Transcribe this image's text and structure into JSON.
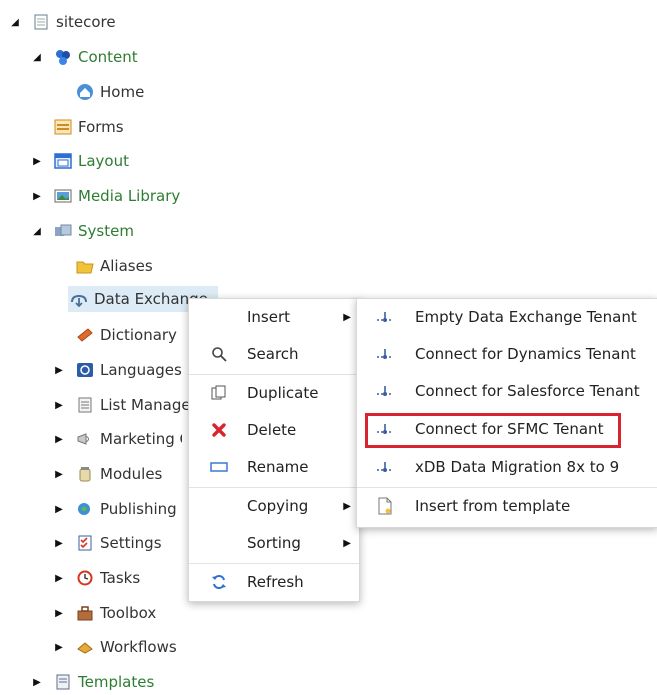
{
  "tree": {
    "items": [
      {
        "label": "sitecore",
        "icon": "page-icon",
        "expanded": true
      },
      {
        "label": "Content",
        "icon": "content-icon",
        "expanded": true
      },
      {
        "label": "Home",
        "icon": "home-icon",
        "expanded": null
      },
      {
        "label": "Forms",
        "icon": "forms-icon",
        "expanded": null
      },
      {
        "label": "Layout",
        "icon": "layout-icon",
        "expanded": false
      },
      {
        "label": "Media Library",
        "icon": "media-icon",
        "expanded": false
      },
      {
        "label": "System",
        "icon": "system-icon",
        "expanded": true
      },
      {
        "label": "Aliases",
        "icon": "folder-icon",
        "expanded": null
      },
      {
        "label": "Data Exchange",
        "icon": "data-exchange-icon",
        "expanded": null,
        "selected": true
      },
      {
        "label": "Dictionary",
        "icon": "book-icon",
        "expanded": null
      },
      {
        "label": "Languages",
        "icon": "globe-icon",
        "expanded": false
      },
      {
        "label": "List Manager",
        "icon": "list-icon",
        "expanded": false
      },
      {
        "label": "Marketing Control Panel",
        "icon": "megaphone-icon",
        "expanded": false
      },
      {
        "label": "Modules",
        "icon": "jar-icon",
        "expanded": false
      },
      {
        "label": "Publishing targets",
        "icon": "publish-icon",
        "expanded": false
      },
      {
        "label": "Settings",
        "icon": "checklist-icon",
        "expanded": false
      },
      {
        "label": "Tasks",
        "icon": "clock-icon",
        "expanded": false
      },
      {
        "label": "Toolbox",
        "icon": "toolbox-icon",
        "expanded": false
      },
      {
        "label": "Workflows",
        "icon": "workflow-icon",
        "expanded": false
      },
      {
        "label": "Templates",
        "icon": "templates-icon",
        "expanded": false
      }
    ]
  },
  "context_menu": {
    "items": [
      {
        "label": "Insert",
        "icon": "",
        "submenu": true
      },
      {
        "label": "Search",
        "icon": "search-icon",
        "submenu": false
      },
      {
        "label": "Duplicate",
        "icon": "duplicate-icon",
        "submenu": false
      },
      {
        "label": "Delete",
        "icon": "delete-icon",
        "submenu": false
      },
      {
        "label": "Rename",
        "icon": "rename-icon",
        "submenu": false
      },
      {
        "label": "Copying",
        "icon": "",
        "submenu": true
      },
      {
        "label": "Sorting",
        "icon": "",
        "submenu": true
      },
      {
        "label": "Refresh",
        "icon": "refresh-icon",
        "submenu": false
      }
    ]
  },
  "insert_submenu": {
    "items": [
      {
        "label": "Empty Data Exchange Tenant",
        "icon": "tenant-icon"
      },
      {
        "label": "Connect for Dynamics Tenant",
        "icon": "tenant-icon"
      },
      {
        "label": "Connect for Salesforce Tenant",
        "icon": "tenant-icon"
      },
      {
        "label": "Connect for SFMC Tenant",
        "icon": "tenant-icon",
        "highlighted": true
      },
      {
        "label": "xDB Data Migration 8x to 9",
        "icon": "tenant-icon"
      },
      {
        "label": "Insert from template",
        "icon": "template-icon"
      }
    ]
  },
  "colors": {
    "green_label": "#2e7d32",
    "selection": "#dcebf5",
    "highlight_box": "#d9232e"
  }
}
